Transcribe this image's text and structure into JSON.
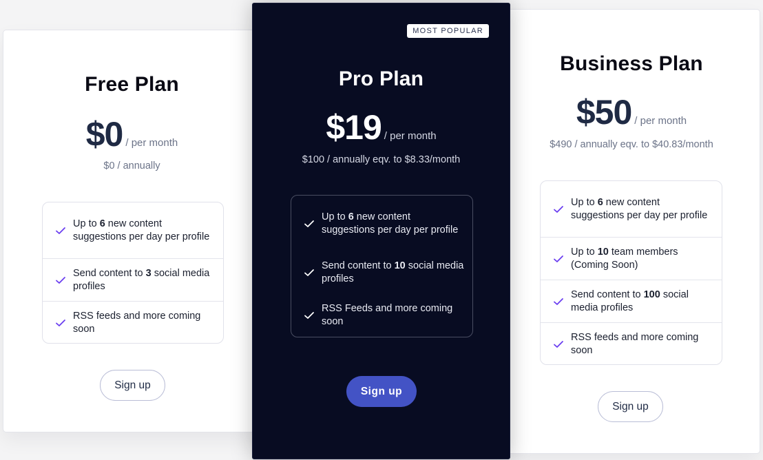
{
  "plans": {
    "free": {
      "title": "Free Plan",
      "price": "$0",
      "per": "/ per month",
      "annual": "$0 / annually",
      "features": [
        {
          "pre": "Up to ",
          "num": "6",
          "post": " new content suggestions per day per profile"
        },
        {
          "pre": "Send content to ",
          "num": "3",
          "post": " social media profiles"
        },
        {
          "pre": "RSS feeds and more coming soon",
          "num": "",
          "post": ""
        }
      ],
      "cta": "Sign up"
    },
    "pro": {
      "badge": "MOST POPULAR",
      "title": "Pro Plan",
      "price": "$19",
      "per": "/ per month",
      "annual": "$100 / annually eqv. to $8.33/month",
      "features": [
        {
          "pre": "Up to ",
          "num": "6",
          "post": " new content suggestions per day per profile"
        },
        {
          "pre": "Send content to ",
          "num": "10",
          "post": " social media profiles"
        },
        {
          "pre": "RSS Feeds and more coming soon",
          "num": "",
          "post": ""
        }
      ],
      "cta": "Sign up"
    },
    "business": {
      "title": "Business Plan",
      "price": "$50",
      "per": "/ per month",
      "annual": "$490 / annually eqv. to $40.83/month",
      "features": [
        {
          "pre": "Up to ",
          "num": "6",
          "post": " new content suggestions per day per profile"
        },
        {
          "pre": "Up to ",
          "num": "10",
          "post": " team members (Coming Soon)"
        },
        {
          "pre": "Send content to ",
          "num": "100",
          "post": " social media profiles"
        },
        {
          "pre": "RSS feeds and more coming soon",
          "num": "",
          "post": ""
        }
      ],
      "cta": "Sign up"
    }
  },
  "colors": {
    "accent_check": "#6a3df0",
    "pro_background": "#080c22",
    "pro_button": "#4353c5"
  }
}
